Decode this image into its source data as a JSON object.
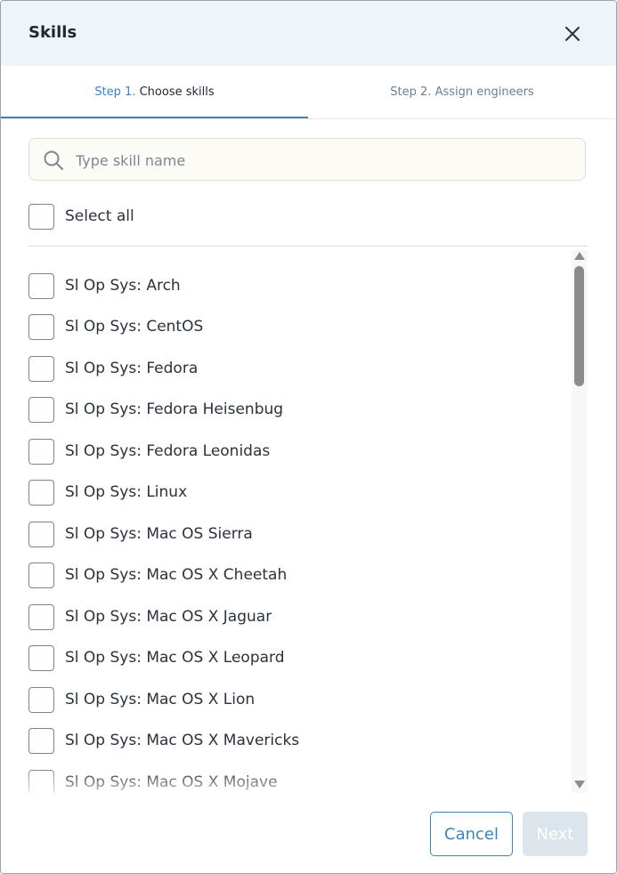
{
  "dialog": {
    "title": "Skills",
    "close_icon": "close-icon"
  },
  "tabs": [
    {
      "prefix": "Step 1.",
      "label": "Choose skills",
      "active": true
    },
    {
      "prefix": "Step 2.",
      "label": "Assign engineers",
      "active": false
    }
  ],
  "search": {
    "placeholder": "Type skill name",
    "value": "",
    "icon": "search-icon"
  },
  "select_all": {
    "label": "Select all",
    "checked": false
  },
  "skills": [
    {
      "label": "Sl Op Sys: Arch",
      "checked": false
    },
    {
      "label": "Sl Op Sys: CentOS",
      "checked": false
    },
    {
      "label": "Sl Op Sys: Fedora",
      "checked": false
    },
    {
      "label": "Sl Op Sys: Fedora Heisenbug",
      "checked": false
    },
    {
      "label": "Sl Op Sys: Fedora Leonidas",
      "checked": false
    },
    {
      "label": "Sl Op Sys: Linux",
      "checked": false
    },
    {
      "label": "Sl Op Sys: Mac OS Sierra",
      "checked": false
    },
    {
      "label": "Sl Op Sys: Mac OS X Cheetah",
      "checked": false
    },
    {
      "label": "Sl Op Sys: Mac OS X Jaguar",
      "checked": false
    },
    {
      "label": "Sl Op Sys: Mac OS X Leopard",
      "checked": false
    },
    {
      "label": "Sl Op Sys: Mac OS X Lion",
      "checked": false
    },
    {
      "label": "Sl Op Sys: Mac OS X Mavericks",
      "checked": false
    },
    {
      "label": "Sl Op Sys: Mac OS X Mojave",
      "checked": false
    }
  ],
  "footer": {
    "cancel_label": "Cancel",
    "next_label": "Next",
    "next_enabled": false
  },
  "colors": {
    "accent": "#3b84c4",
    "header_bg": "#eef4fa",
    "disabled_button": "#dde5ec"
  }
}
